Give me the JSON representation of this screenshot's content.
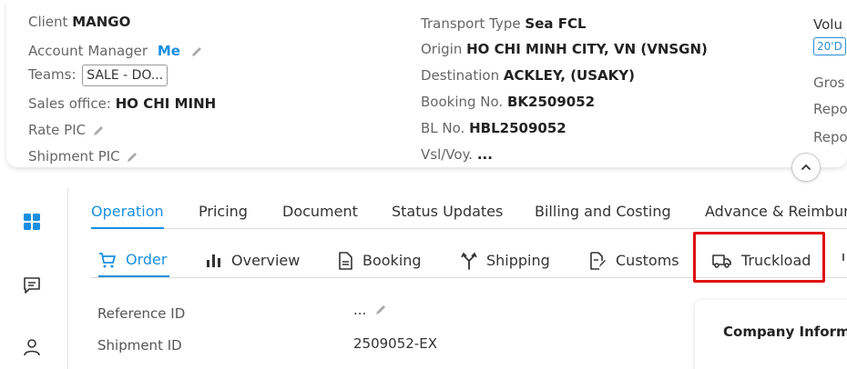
{
  "header": {
    "client_label": "Client",
    "client_value": "MANGO",
    "account_manager_label": "Account Manager",
    "account_manager_value": "Me",
    "teams_label": "Teams:",
    "teams_value": "SALE - DO...",
    "sales_office_label": "Sales office:",
    "sales_office_value": "HO CHI MINH",
    "rate_pic_label": "Rate PIC",
    "shipment_pic_label": "Shipment PIC",
    "transport_type_label": "Transport Type",
    "transport_type_value": "Sea FCL",
    "origin_label": "Origin",
    "origin_value": "HO CHI MINH CITY, VN (VNSGN)",
    "destination_label": "Destination",
    "destination_value": "ACKLEY, (USAKY)",
    "booking_no_label": "Booking No.",
    "booking_no_value": "BK2509052",
    "bl_no_label": "BL No.",
    "bl_no_value": "HBL2509052",
    "vsl_voy_label": "Vsl/Voy.",
    "vsl_voy_value": "...",
    "volume_label": "Volu",
    "volume_tag": "20'D",
    "gross_label": "Gros",
    "repo1_label": "Repo",
    "repo2_label": "Repo"
  },
  "main_tabs": [
    {
      "label": "Operation",
      "active": true
    },
    {
      "label": "Pricing"
    },
    {
      "label": "Document"
    },
    {
      "label": "Status Updates"
    },
    {
      "label": "Billing and Costing"
    },
    {
      "label": "Advance & Reimbur"
    }
  ],
  "sub_tabs": [
    {
      "label": "Order",
      "icon": "cart-icon",
      "active": true
    },
    {
      "label": "Overview",
      "icon": "bar-chart-icon"
    },
    {
      "label": "Booking",
      "icon": "document-icon"
    },
    {
      "label": "Shipping",
      "icon": "route-icon"
    },
    {
      "label": "Customs",
      "icon": "document-edit-icon"
    },
    {
      "label": "Truckload",
      "icon": "truck-icon"
    }
  ],
  "details": {
    "reference_id_label": "Reference ID",
    "reference_id_value": "...",
    "shipment_id_label": "Shipment ID",
    "shipment_id_value": "2509052-EX"
  },
  "company_card": {
    "title": "Company Inform"
  },
  "colors": {
    "accent": "#1a8fe0",
    "highlight": "#e01010"
  }
}
